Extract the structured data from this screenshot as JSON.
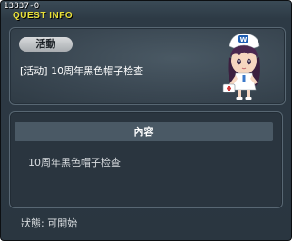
{
  "window": {
    "id": "13837-0",
    "title": "QUEST INFO"
  },
  "quest": {
    "category": "活動",
    "name": "[活动] 10周年黑色帽子检查",
    "npc_icon": "nurse-npc-icon"
  },
  "content": {
    "header": "內容",
    "text": "10周年黑色帽子检查"
  },
  "status": {
    "text": "狀態: 可開始"
  },
  "colors": {
    "title": "#e8e03a",
    "panel": "#3a4752",
    "header_bar": "#4a5965"
  }
}
